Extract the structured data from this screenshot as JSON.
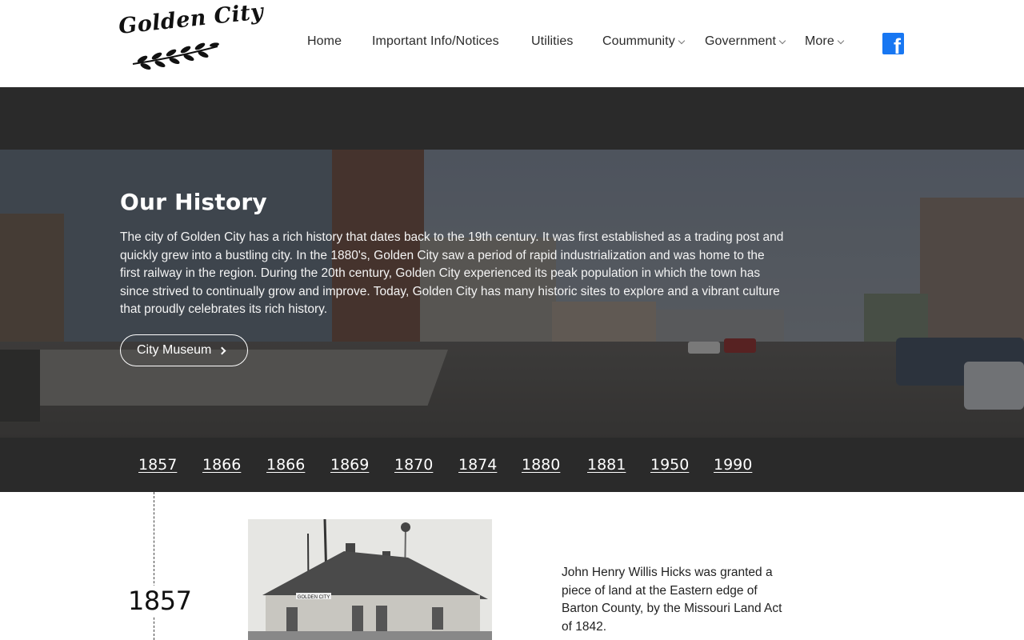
{
  "header": {
    "logo_text": "Golden City",
    "nav": [
      {
        "label": "Home",
        "dropdown": false
      },
      {
        "label": "Important Info/Notices",
        "dropdown": false
      },
      {
        "label": "Utilities",
        "dropdown": false
      },
      {
        "label": "Coummunity",
        "dropdown": true
      },
      {
        "label": "Government",
        "dropdown": true
      },
      {
        "label": "More",
        "dropdown": true
      }
    ],
    "social": {
      "icon": "facebook-icon",
      "glyph": "f",
      "color": "#1877f2"
    }
  },
  "hero": {
    "title": "Our History",
    "text": "The city of Golden City has a rich history that dates back to the 19th century. It was first established as a trading post and quickly grew into a bustling city. In the 1880's, Golden City saw a period of rapid industrialization and was home to the first railway in the region. During the 20th century, Golden City experienced its peak population in which the town has since strived to continually grow and improve. Today, Golden City has many historic sites to explore and a vibrant culture that proudly celebrates its rich history.",
    "button_label": "City Museum"
  },
  "years": [
    "1857",
    "1866",
    "1866",
    "1869",
    "1870",
    "1874",
    "1880",
    "1881",
    "1950",
    "1990"
  ],
  "timeline": {
    "entry_year": "1857",
    "entry_text": "John Henry Willis Hicks was granted a piece of land at the Eastern edge of Barton County, by the Missouri Land Act of 1842.",
    "photo_sign": "GOLDEN CITY"
  },
  "colors": {
    "dark_band": "#2a2a2a",
    "text": "#222222",
    "facebook": "#1877f2"
  }
}
